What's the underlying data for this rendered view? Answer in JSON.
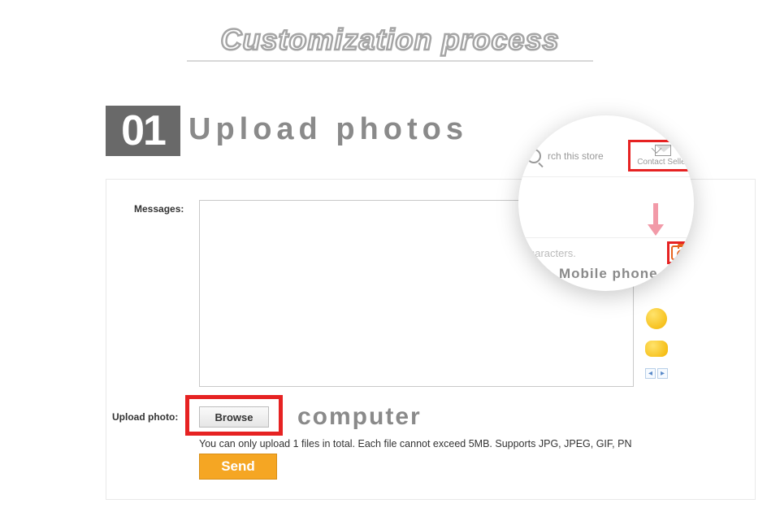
{
  "title": "Customization process",
  "step": {
    "number": "01",
    "title": "Upload photos"
  },
  "form": {
    "messages_label": "Messages:",
    "upload_label": "Upload photo:",
    "browse_label": "Browse",
    "upload_hint": "You can only upload 1 files in total. Each file cannot exceed 5MB. Supports JPG, JPEG, GIF, PN",
    "send_label": "Send"
  },
  "annotations": {
    "computer_label": "computer",
    "mobile_label": "Mobile phone"
  },
  "magnifier": {
    "search_text": "rch this store",
    "contact_label": "Contact Seller",
    "placeholder_text": "haracters."
  },
  "pager": {
    "prev": "◂",
    "next": "▸"
  }
}
